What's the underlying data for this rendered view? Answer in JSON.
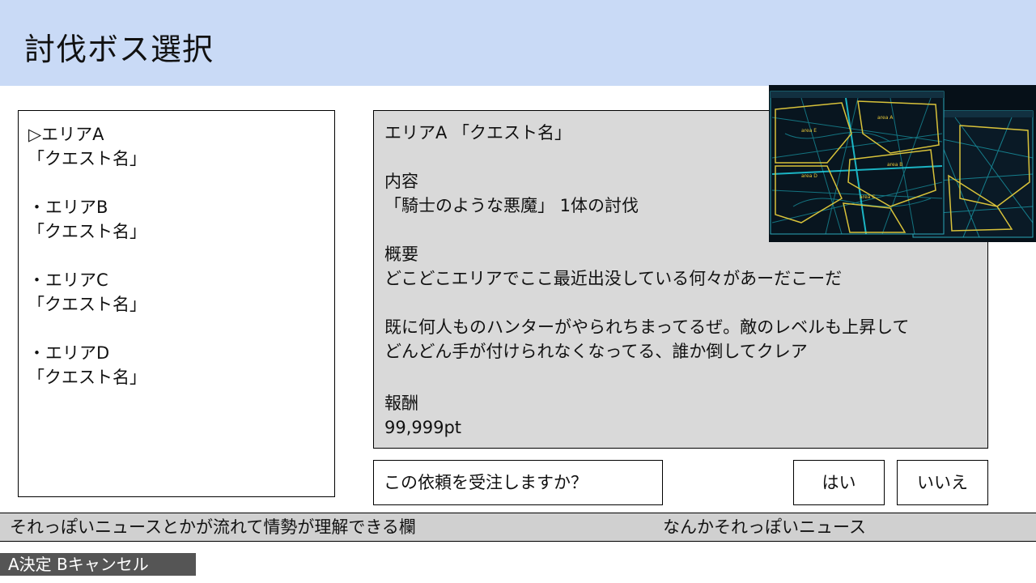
{
  "header": {
    "title": "討伐ボス選択"
  },
  "quest_list": [
    {
      "marker": "▷",
      "area": "エリアA",
      "quest": "「クエスト名」"
    },
    {
      "marker": "・",
      "area": "エリアB",
      "quest": "「クエスト名」"
    },
    {
      "marker": "・",
      "area": "エリアC",
      "quest": "「クエスト名」"
    },
    {
      "marker": "・",
      "area": "エリアD",
      "quest": "「クエスト名」"
    }
  ],
  "detail": {
    "heading": "エリアA 「クエスト名」",
    "content_label": "内容",
    "content_text": "「騎士のような悪魔」 1体の討伐",
    "summary_label": "概要",
    "summary_line1": "どこどこエリアでここ最近出没している何々があーだこーだ",
    "summary_line2": "既に何人ものハンターがやられちまってるぜ。敵のレベルも上昇して",
    "summary_line3": "どんどん手が付けられなくなってる、誰か倒してクレア",
    "reward_label": "報酬",
    "reward_value": "99,999pt"
  },
  "map": {
    "areas": [
      "area A",
      "area B",
      "area C",
      "area D",
      "area E"
    ],
    "accent_color": "#1fd0e0",
    "boundary_color": "#d8c23a"
  },
  "confirm": {
    "question": "この依頼を受注しますか？",
    "yes_label": "はい",
    "no_label": "いいえ"
  },
  "news": {
    "text1": "それっぽいニュースとかが流れて情勢が理解できる欄",
    "text2": "なんかそれっぽいニュース"
  },
  "controls": {
    "hint": "A決定 Bキャンセル"
  }
}
